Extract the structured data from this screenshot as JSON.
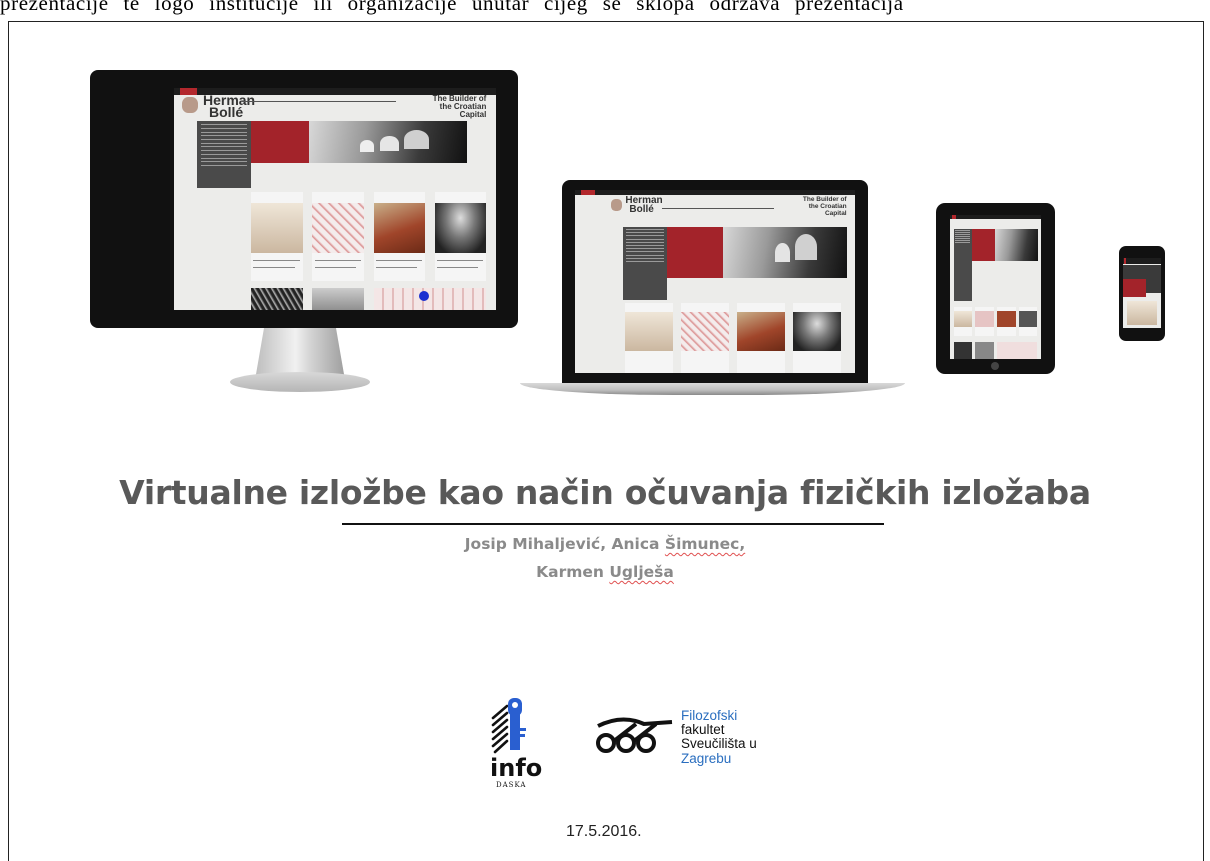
{
  "document": {
    "top_text": "prezentacije te logo institucije ili organizacije unutar čijeg se sklopa održava prezentacija",
    "slide": {
      "mockup_site": {
        "logo_line1": "Herman",
        "logo_line2": "Bollé",
        "tagline_line1": "The Builder of",
        "tagline_line2": "the Croatian",
        "tagline_line3": "Capital"
      },
      "title": "Virtualne izložbe kao način očuvanja fizičkih izložaba",
      "authors": {
        "author1": "Josip Mihaljević,",
        "author2_first": "Anica",
        "author2_last": "Šimunec",
        "author2_comma": ",",
        "author3_first": "Karmen",
        "author3_last": "Uglješa"
      },
      "logo_infodaska": {
        "word": "info",
        "subword": "DASKA"
      },
      "logo_ffzg": {
        "line1": "Filozofski",
        "line2": "fakultet",
        "line3": "Sveučilišta u",
        "line4": "Zagrebu"
      },
      "date": "17.5.2016."
    },
    "colors": {
      "site_red": "#a3232a",
      "title_gray": "#595959",
      "author_gray": "#8a8a8a",
      "ffzg_blue": "#2a6ebf"
    }
  }
}
